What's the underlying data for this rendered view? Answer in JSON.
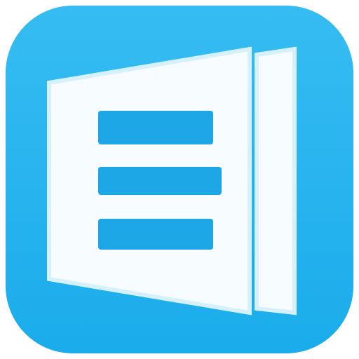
{
  "icon": {
    "name": "document-reader-app-icon",
    "background_color": "#1AACEB",
    "background_highlight": "#36BCF2",
    "page_color": "#F6FCFF",
    "text_line_color": "#1CA6E6",
    "text_line_count": 3
  }
}
